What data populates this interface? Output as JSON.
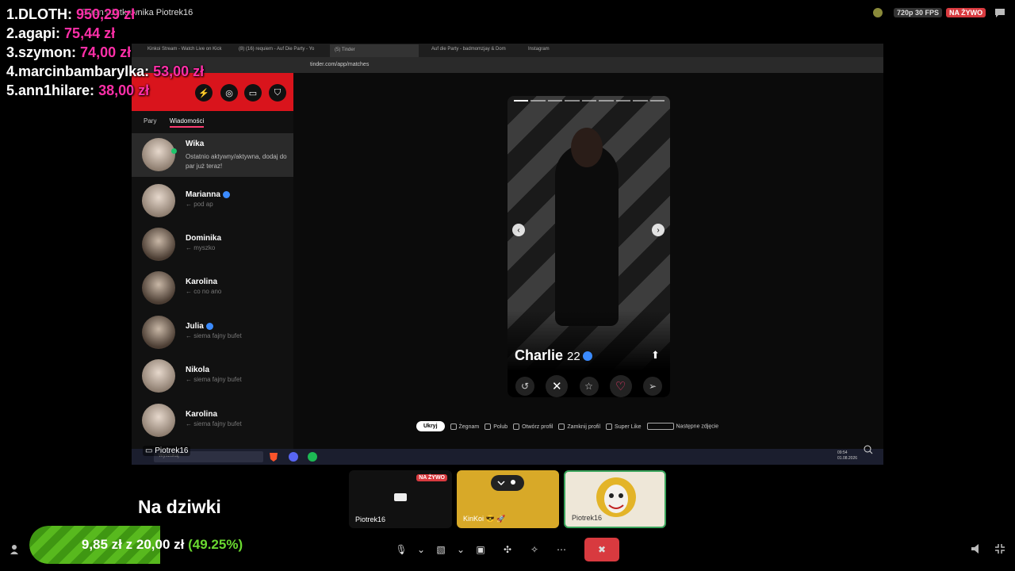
{
  "topbar": {
    "title": "Ekran użytkownika Piotrek16",
    "fps": "720p 30 FPS",
    "live": "NA ŻYWO"
  },
  "donors": [
    {
      "rank": "1.",
      "name": "DLOTH:",
      "amount": "950,29 zł"
    },
    {
      "rank": "2.",
      "name": "agapi:",
      "amount": "75,44 zł"
    },
    {
      "rank": "3.",
      "name": "szymon:",
      "amount": "74,00 zł"
    },
    {
      "rank": "4.",
      "name": "marcinbambarylka:",
      "amount": "53,00 zł"
    },
    {
      "rank": "5.",
      "name": "ann1hilare:",
      "amount": "38,00 zł"
    }
  ],
  "browser": {
    "tabs": [
      "Kinkoi Stream - Watch Live on Kick",
      "(8) (16) requiem - Auf Die Party - Yo",
      "(5) Tinder",
      "Auf die Party - badmomzjay & Dom",
      "Instagram"
    ],
    "url": "tinder.com/app/matches"
  },
  "tinder": {
    "subtabs": [
      "Pary",
      "Wiadomości"
    ],
    "conversations": [
      {
        "name": "Wika",
        "message": "Ostatnio aktywny/aktywna, dodaj do par już teraz!"
      },
      {
        "name": "Marianna",
        "message": "← pod ap"
      },
      {
        "name": "Dominika",
        "message": "← myszko"
      },
      {
        "name": "Karolina",
        "message": "← co no ano"
      },
      {
        "name": "Julia",
        "message": "← siema fajny bufet"
      },
      {
        "name": "Nikola",
        "message": "← siema fajny bufet"
      },
      {
        "name": "Karolina",
        "message": "← siema fajny bufet"
      }
    ],
    "profile": {
      "name": "Charlie",
      "age": "22"
    },
    "hints": {
      "hide": "Ukryj",
      "nope": "Żegnam",
      "like": "Polub",
      "open": "Otwórz profil",
      "close": "Zamknij profil",
      "superlike": "Super Like",
      "next": "Następne zdjęcie"
    }
  },
  "taskbar": {
    "search": "Wyszukaj",
    "time": "09:54",
    "date": "01.08.2026"
  },
  "screen_label": "Piotrek16",
  "participants": [
    {
      "name": "Piotrek16",
      "badge": "NA ŻYWO"
    },
    {
      "name": "KinKoi 😎 🚀"
    },
    {
      "name": "Piotrek16"
    }
  ],
  "caption": "Na dziwki",
  "goal": {
    "current": "9,85 zł",
    "sep": "z",
    "target": "20,00 zł",
    "percent": "(49.25%)",
    "fraction": 0.4925
  }
}
